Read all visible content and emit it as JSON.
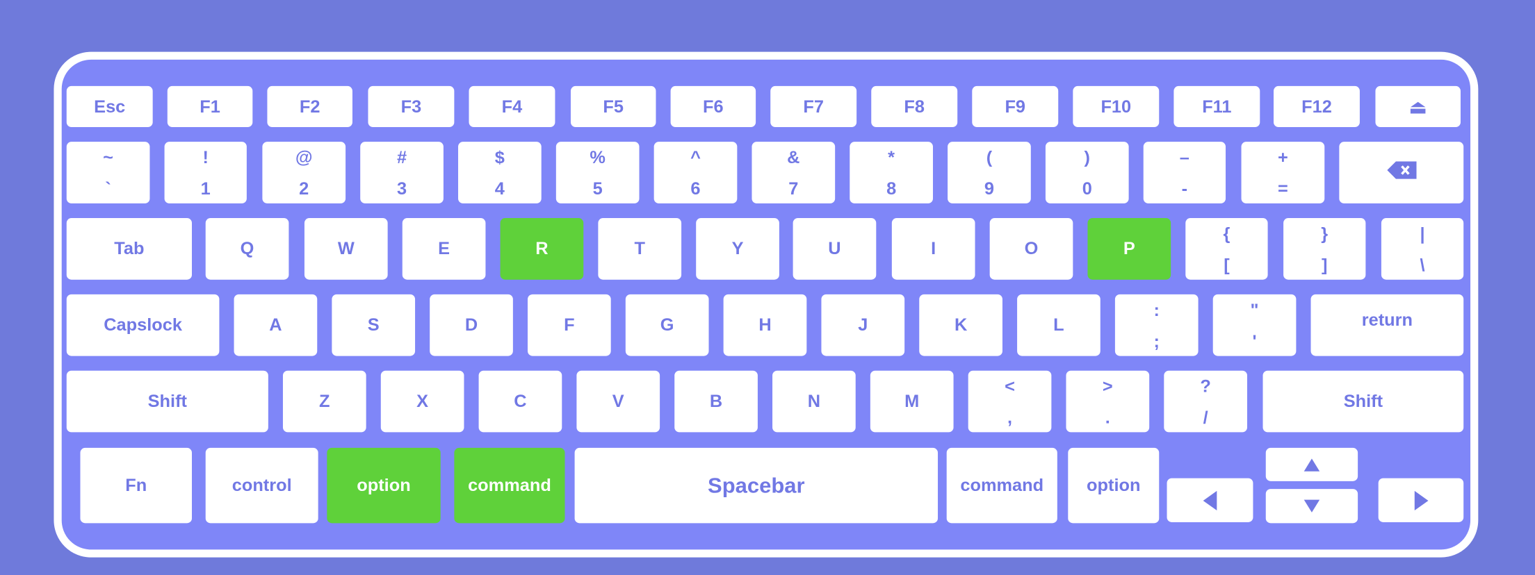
{
  "keyboard": {
    "colors": {
      "background": "#6f7adb",
      "board": "#7f86f8",
      "key": "#ffffff",
      "label": "#7178e4",
      "highlight": "#5fd13a"
    },
    "rows": [
      [
        {
          "label": "Esc"
        },
        {
          "label": "F1"
        },
        {
          "label": "F2"
        },
        {
          "label": "F3"
        },
        {
          "label": "F4"
        },
        {
          "label": "F5"
        },
        {
          "label": "F6"
        },
        {
          "label": "F7"
        },
        {
          "label": "F8"
        },
        {
          "label": "F9"
        },
        {
          "label": "F10"
        },
        {
          "label": "F11"
        },
        {
          "label": "F12"
        },
        {
          "icon": "eject-icon",
          "label": "⏏"
        }
      ],
      [
        {
          "top": "~",
          "bottom": "`"
        },
        {
          "top": "!",
          "bottom": "1"
        },
        {
          "top": "@",
          "bottom": "2"
        },
        {
          "top": "#",
          "bottom": "3"
        },
        {
          "top": "$",
          "bottom": "4"
        },
        {
          "top": "%",
          "bottom": "5"
        },
        {
          "top": "^",
          "bottom": "6"
        },
        {
          "top": "&",
          "bottom": "7"
        },
        {
          "top": "*",
          "bottom": "8"
        },
        {
          "top": "(",
          "bottom": "9"
        },
        {
          "top": ")",
          "bottom": "0"
        },
        {
          "top": "–",
          "bottom": "-"
        },
        {
          "top": "+",
          "bottom": "="
        },
        {
          "icon": "backspace-icon"
        }
      ],
      [
        {
          "label": "Tab"
        },
        {
          "label": "Q"
        },
        {
          "label": "W"
        },
        {
          "label": "E"
        },
        {
          "label": "R",
          "highlighted": true
        },
        {
          "label": "T"
        },
        {
          "label": "Y"
        },
        {
          "label": "U"
        },
        {
          "label": "I"
        },
        {
          "label": "O"
        },
        {
          "label": "P",
          "highlighted": true
        },
        {
          "top": "{",
          "bottom": "["
        },
        {
          "top": "}",
          "bottom": "]"
        },
        {
          "top": "|",
          "bottom": "\\"
        }
      ],
      [
        {
          "label": "Capslock"
        },
        {
          "label": "A"
        },
        {
          "label": "S"
        },
        {
          "label": "D"
        },
        {
          "label": "F"
        },
        {
          "label": "G"
        },
        {
          "label": "H"
        },
        {
          "label": "J"
        },
        {
          "label": "K"
        },
        {
          "label": "L"
        },
        {
          "top": ":",
          "bottom": ";"
        },
        {
          "top": "\"",
          "bottom": "'"
        },
        {
          "label": "return"
        }
      ],
      [
        {
          "label": "Shift"
        },
        {
          "label": "Z"
        },
        {
          "label": "X"
        },
        {
          "label": "C"
        },
        {
          "label": "V"
        },
        {
          "label": "B"
        },
        {
          "label": "N"
        },
        {
          "label": "M"
        },
        {
          "top": "<",
          "bottom": ","
        },
        {
          "top": ">",
          "bottom": "."
        },
        {
          "top": "?",
          "bottom": "/"
        },
        {
          "label": "Shift"
        }
      ],
      [
        {
          "label": "Fn"
        },
        {
          "label": "control"
        },
        {
          "label": "option",
          "highlighted": true
        },
        {
          "label": "command",
          "highlighted": true
        },
        {
          "label": "Spacebar"
        },
        {
          "label": "command"
        },
        {
          "label": "option"
        },
        {
          "icon": "arrow-left-icon"
        },
        {
          "icon": "arrow-up-icon"
        },
        {
          "icon": "arrow-down-icon"
        },
        {
          "icon": "arrow-right-icon"
        }
      ]
    ]
  }
}
